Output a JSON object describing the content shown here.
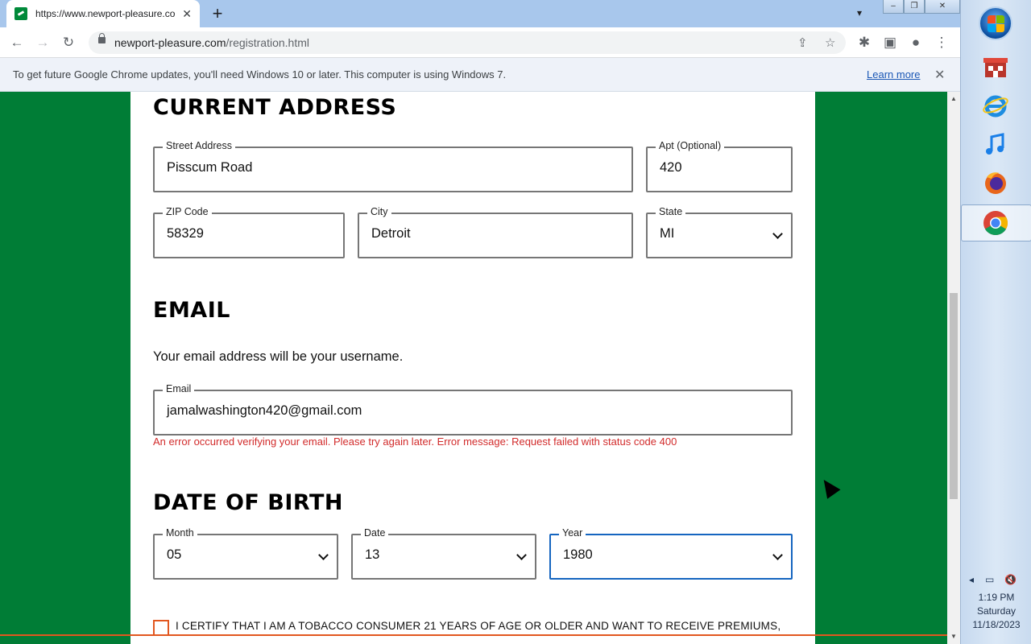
{
  "browser": {
    "tab_title": "https://www.newport-pleasure.co",
    "url_host": "newport-pleasure.com",
    "url_path": "/registration.html",
    "infobar_message": "To get future Google Chrome updates, you'll need Windows 10 or later. This computer is using Windows 7.",
    "infobar_link": "Learn more"
  },
  "address": {
    "heading": "CURRENT ADDRESS",
    "street": {
      "label": "Street Address",
      "value": "Pisscum Road"
    },
    "apt": {
      "label": "Apt (Optional)",
      "value": "420"
    },
    "zip": {
      "label": "ZIP Code",
      "value": "58329"
    },
    "city": {
      "label": "City",
      "value": "Detroit"
    },
    "state": {
      "label": "State",
      "value": "MI"
    }
  },
  "email": {
    "heading": "EMAIL",
    "subtext": "Your email address will be your username.",
    "label": "Email",
    "value": "jamalwashington420@gmail.com",
    "error": "An error occurred verifying your email. Please try again later. Error message: Request failed with status code 400"
  },
  "dob": {
    "heading": "DATE OF BIRTH",
    "month": {
      "label": "Month",
      "value": "05"
    },
    "date": {
      "label": "Date",
      "value": "13"
    },
    "year": {
      "label": "Year",
      "value": "1980"
    }
  },
  "certify_text": "I CERTIFY THAT I AM A TOBACCO CONSUMER 21 YEARS OF AGE OR OLDER AND WANT TO RECEIVE PREMIUMS,",
  "taskbar": {
    "time": "1:19 PM",
    "day": "Saturday",
    "date": "11/18/2023",
    "colors": {
      "accent": "#007d36",
      "error": "#d22b2b",
      "checkbox": "#e2571f"
    }
  }
}
